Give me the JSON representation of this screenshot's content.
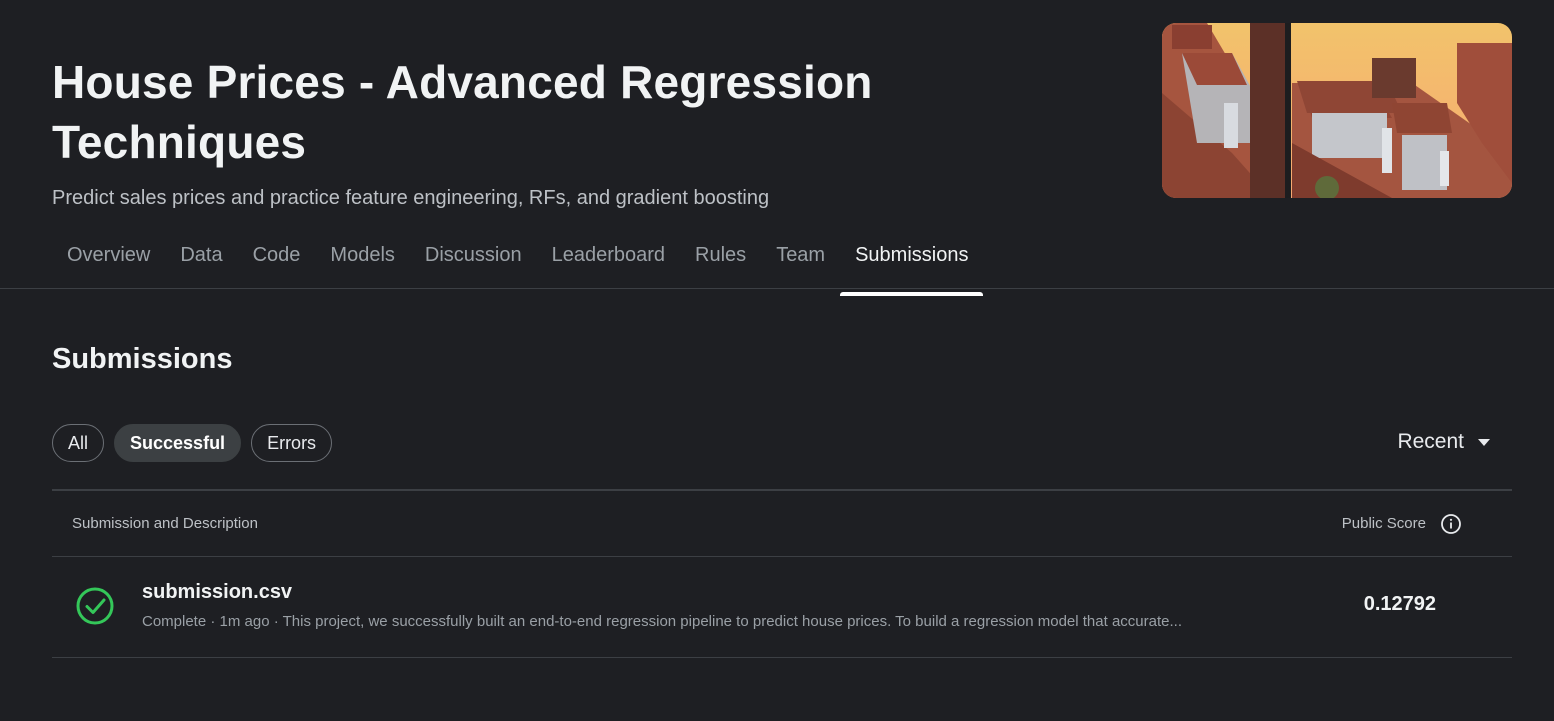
{
  "competition": {
    "title": "House Prices - Advanced Regression Techniques",
    "subtitle": "Predict sales prices and practice feature engineering, RFs, and gradient boosting"
  },
  "tabs": [
    {
      "label": "Overview"
    },
    {
      "label": "Data"
    },
    {
      "label": "Code"
    },
    {
      "label": "Models"
    },
    {
      "label": "Discussion"
    },
    {
      "label": "Leaderboard"
    },
    {
      "label": "Rules"
    },
    {
      "label": "Team"
    },
    {
      "label": "Submissions",
      "active": true
    }
  ],
  "submissions": {
    "heading": "Submissions",
    "filters": [
      {
        "label": "All"
      },
      {
        "label": "Successful",
        "selected": true
      },
      {
        "label": "Errors"
      }
    ],
    "sort": {
      "label": "Recent"
    },
    "table": {
      "col_left": "Submission and Description",
      "col_right": "Public Score",
      "rows": [
        {
          "filename": "submission.csv",
          "meta": "Complete · 1m ago · This project, we successfully built an end-to-end regression pipeline to predict house prices. To build a regression model that accurate...",
          "score": "0.12792",
          "status_icon": "check-circle-icon"
        }
      ]
    }
  },
  "colors": {
    "background": "#1e1f23",
    "success": "#34c759",
    "divider": "#3c3f44"
  }
}
